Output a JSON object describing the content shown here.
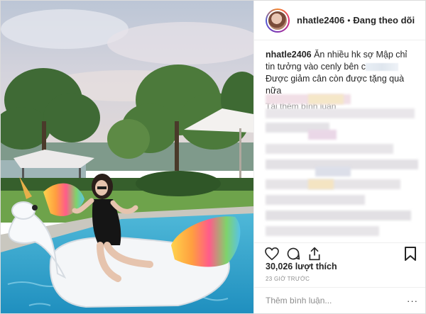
{
  "post": {
    "username": "nhatle2406",
    "separator": "•",
    "follow_status": "Đang theo dõi",
    "caption": {
      "username": "nhatle2406",
      "line1": " Ăn nhiều hk sợ Mập chỉ tin tưởng vào cenly bên c",
      "line2": "Được giảm cân còn được tặng quà nữa"
    },
    "load_more": "Tải thêm bình luận",
    "likes": "30,026 lượt thích",
    "time": "23 GIỜ TRƯỚC",
    "comment_placeholder": "Thêm bình luận...",
    "more": "···"
  },
  "icons": {
    "like": "heart-icon",
    "comment": "comment-icon",
    "share": "share-icon",
    "save": "bookmark-icon"
  },
  "colors": {
    "text": "#262626",
    "secondary": "#8e8e8e",
    "border": "#efefef"
  }
}
